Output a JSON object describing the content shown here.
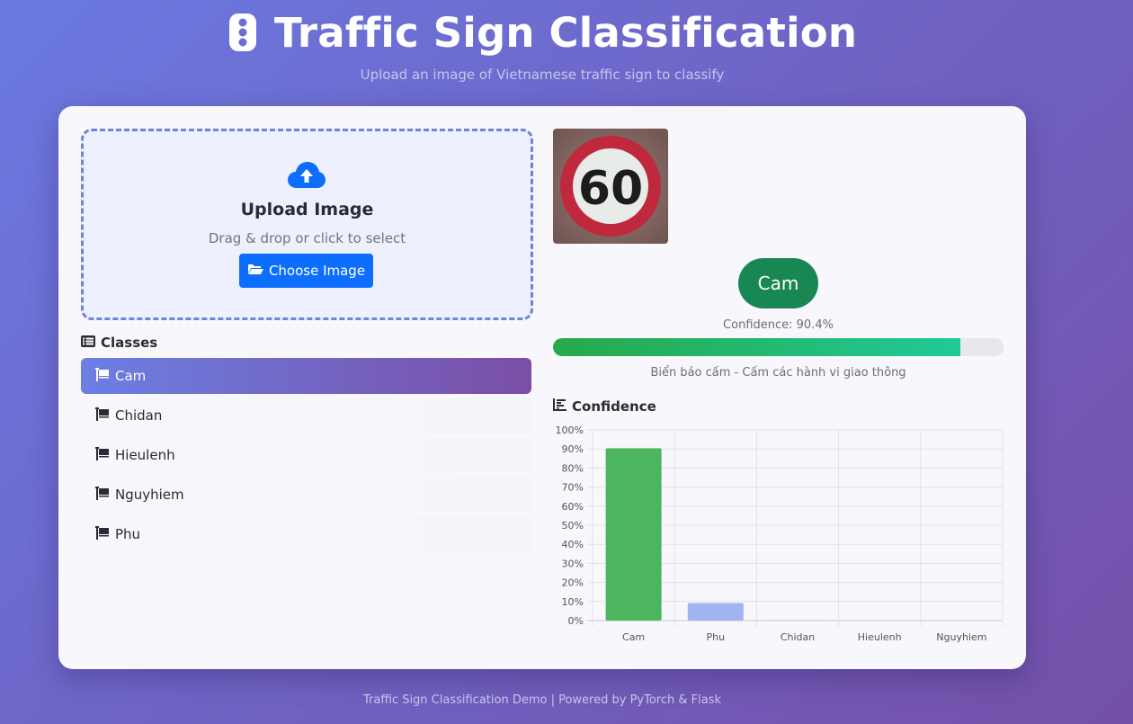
{
  "header": {
    "title": "Traffic Sign Classification",
    "subtitle": "Upload an image of Vietnamese traffic sign to classify",
    "icon": "traffic-light-icon"
  },
  "upload": {
    "icon": "cloud-upload-icon",
    "title": "Upload Image",
    "subtitle": "Drag & drop or click to select",
    "button_label": "Choose Image",
    "button_icon": "folder-open-icon"
  },
  "classes": {
    "heading": "Classes",
    "heading_icon": "list-icon",
    "item_icon": "flag-icon",
    "items": [
      {
        "label": "Cam",
        "active": true
      },
      {
        "label": "Chidan",
        "active": false
      },
      {
        "label": "Hieulenh",
        "active": false
      },
      {
        "label": "Nguyhiem",
        "active": false
      },
      {
        "label": "Phu",
        "active": false
      }
    ]
  },
  "result": {
    "image_text": "60",
    "prediction": "Cam",
    "confidence_text": "Confidence: 90.4%",
    "confidence_value": 0.904,
    "description": "Biển báo cấm - Cấm các hành vi giao thông"
  },
  "chart_section": {
    "heading": "Confidence",
    "heading_icon": "chart-bar-icon"
  },
  "chart_data": {
    "type": "bar",
    "categories": [
      "Cam",
      "Phu",
      "Chidan",
      "Hieulenh",
      "Nguyhiem"
    ],
    "values": [
      90.4,
      9.2,
      0.2,
      0.1,
      0.1
    ],
    "ylim": [
      0,
      100
    ],
    "y_ticks": [
      "0%",
      "10%",
      "20%",
      "30%",
      "40%",
      "50%",
      "60%",
      "70%",
      "80%",
      "90%",
      "100%"
    ],
    "colors": [
      "#4cb560",
      "#a3b3f2",
      "#a3b3f2",
      "#a3b3f2",
      "#a3b3f2"
    ],
    "grid": true
  },
  "footer": {
    "text": "Traffic Sign Classification Demo | Powered by PyTorch & Flask"
  },
  "colors": {
    "primary": "#0d6efd",
    "success": "#198754",
    "accent_start": "#6b7fe3",
    "accent_end": "#7a4ea6"
  }
}
